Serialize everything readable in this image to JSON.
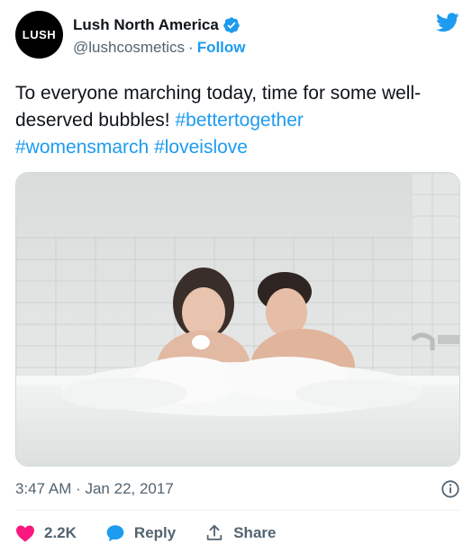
{
  "account": {
    "display_name": "Lush North America",
    "handle": "@lushcosmetics",
    "separator": "·",
    "follow_label": "Follow",
    "avatar_text": "LUSH",
    "verified": true
  },
  "tweet": {
    "text_plain": "To everyone marching today, time for some well-deserved bubbles! ",
    "hashtags": [
      "#bettertogether",
      "#womensmarch",
      "#loveislove"
    ],
    "timestamp": "3:47 AM · Jan 22, 2017"
  },
  "actions": {
    "likes": "2.2K",
    "reply_label": "Reply",
    "share_label": "Share"
  },
  "colors": {
    "brand_blue": "#1d9bf0",
    "like_pink": "#f91880",
    "text_primary": "#0f1419",
    "text_secondary": "#536471"
  },
  "icons": [
    "verified-badge-icon",
    "twitter-bird-icon",
    "info-icon",
    "heart-icon",
    "reply-bubble-icon",
    "share-icon"
  ]
}
